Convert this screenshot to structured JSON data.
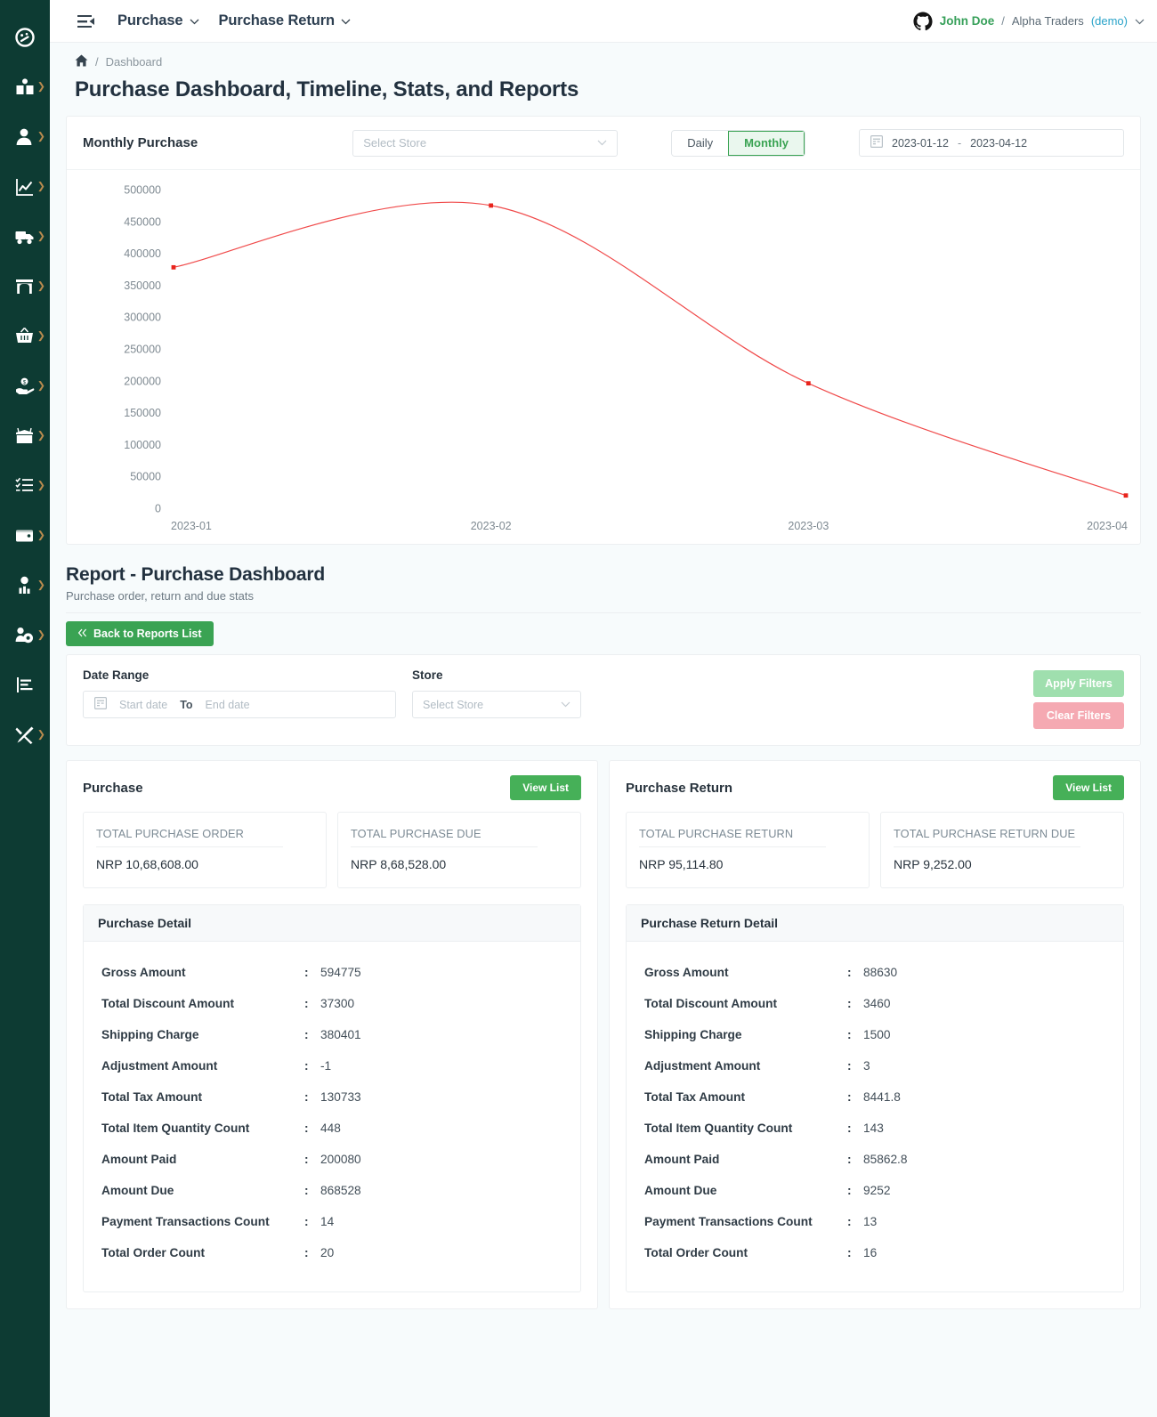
{
  "sidebar": {
    "items": [
      {
        "name": "dashboard",
        "icon": "speedometer-icon",
        "submenu": false
      },
      {
        "name": "catalog",
        "icon": "open-book-icon",
        "submenu": true
      },
      {
        "name": "customers",
        "icon": "user-icon",
        "submenu": true
      },
      {
        "name": "sales",
        "icon": "chart-line-icon",
        "submenu": true
      },
      {
        "name": "shipping",
        "icon": "truck-icon",
        "submenu": true
      },
      {
        "name": "store",
        "icon": "storefront-icon",
        "submenu": true
      },
      {
        "name": "purchase",
        "icon": "basket-icon",
        "submenu": true
      },
      {
        "name": "expense",
        "icon": "hand-money-icon",
        "submenu": true
      },
      {
        "name": "inventory",
        "icon": "box-open-icon",
        "submenu": true
      },
      {
        "name": "tasks",
        "icon": "checklist-icon",
        "submenu": true
      },
      {
        "name": "accounts",
        "icon": "wallet-icon",
        "submenu": true
      },
      {
        "name": "hr",
        "icon": "employee-icon",
        "submenu": true
      },
      {
        "name": "user-management",
        "icon": "users-gear-icon",
        "submenu": true
      },
      {
        "name": "reports",
        "icon": "bar-chart-icon",
        "submenu": false
      },
      {
        "name": "settings",
        "icon": "tools-icon",
        "submenu": true
      }
    ]
  },
  "topnav": {
    "menu_icon": "hamburger-collapse-icon",
    "links": [
      {
        "label": "Purchase"
      },
      {
        "label": "Purchase Return"
      }
    ],
    "account": {
      "avatar_icon": "github-icon",
      "user": "John Doe",
      "separator": "/",
      "org": "Alpha Traders",
      "demo": "(demo)",
      "chevron": "chevron-down-icon"
    }
  },
  "breadcrumb": {
    "home_icon": "home-icon",
    "separator": "/",
    "current": "Dashboard"
  },
  "page": {
    "title": "Purchase Dashboard, Timeline, Stats, and Reports"
  },
  "chart_card": {
    "title": "Monthly Purchase",
    "store_select": {
      "placeholder": "Select Store",
      "value": "",
      "chevron": "chevron-down-icon"
    },
    "segments": [
      {
        "label": "Daily",
        "active": false
      },
      {
        "label": "Monthly",
        "active": true
      }
    ],
    "date_range": {
      "icon": "calendar-icon",
      "start": "2023-01-12",
      "dash": "-",
      "end": "2023-04-12"
    }
  },
  "chart_data": {
    "type": "line",
    "title": "Monthly Purchase",
    "xlabel": "",
    "ylabel": "",
    "categories": [
      "2023-01",
      "2023-02",
      "2023-03",
      "2023-04"
    ],
    "x_tick_labels": [
      "2023-01",
      "2023-02",
      "2023-03",
      "2023-04"
    ],
    "y_tick_labels": [
      "0",
      "50000",
      "100000",
      "150000",
      "200000",
      "250000",
      "300000",
      "350000",
      "400000",
      "450000",
      "500000"
    ],
    "ylim": [
      0,
      500000
    ],
    "y_step": 50000,
    "grid": false,
    "legend": "none",
    "series": [
      {
        "name": "Monthly Purchase",
        "color": "#f04a4a",
        "values": [
          378000,
          475000,
          196000,
          20000
        ]
      }
    ]
  },
  "report": {
    "title": "Report - Purchase Dashboard",
    "subtitle": "Purchase order, return and due stats",
    "back_button": {
      "label": "Back to Reports List",
      "icon": "double-chevron-left-icon"
    }
  },
  "filters": {
    "date_range_label": "Date Range",
    "store_label": "Store",
    "date_icon": "calendar-icon",
    "start_placeholder": "Start date",
    "to_label": "To",
    "end_placeholder": "End date",
    "start_value": "",
    "end_value": "",
    "store_placeholder": "Select Store",
    "store_value": "",
    "store_chevron": "chevron-down-icon",
    "apply_label": "Apply Filters",
    "clear_label": "Clear Filters"
  },
  "panels": [
    {
      "title": "Purchase",
      "view_list_label": "View List",
      "stats": [
        {
          "label": "TOTAL PURCHASE ORDER",
          "value": "NRP 10,68,608.00"
        },
        {
          "label": "TOTAL PURCHASE DUE",
          "value": "NRP 8,68,528.00"
        }
      ],
      "detail_title": "Purchase Detail",
      "rows": [
        {
          "label": "Gross Amount",
          "value": "594775"
        },
        {
          "label": "Total Discount Amount",
          "value": "37300"
        },
        {
          "label": "Shipping Charge",
          "value": "380401"
        },
        {
          "label": "Adjustment Amount",
          "value": "-1"
        },
        {
          "label": "Total Tax Amount",
          "value": "130733"
        },
        {
          "label": "Total Item Quantity Count",
          "value": "448"
        },
        {
          "label": "Amount Paid",
          "value": "200080"
        },
        {
          "label": "Amount Due",
          "value": "868528"
        },
        {
          "label": "Payment Transactions Count",
          "value": "14"
        },
        {
          "label": "Total Order Count",
          "value": "20"
        }
      ]
    },
    {
      "title": "Purchase Return",
      "view_list_label": "View List",
      "stats": [
        {
          "label": "TOTAL PURCHASE RETURN",
          "value": "NRP 95,114.80"
        },
        {
          "label": "TOTAL PURCHASE RETURN DUE",
          "value": "NRP 9,252.00"
        }
      ],
      "detail_title": "Purchase Return Detail",
      "rows": [
        {
          "label": "Gross Amount",
          "value": "88630"
        },
        {
          "label": "Total Discount Amount",
          "value": "3460"
        },
        {
          "label": "Shipping Charge",
          "value": "1500"
        },
        {
          "label": "Adjustment Amount",
          "value": "3"
        },
        {
          "label": "Total Tax Amount",
          "value": "8441.8"
        },
        {
          "label": "Total Item Quantity Count",
          "value": "143"
        },
        {
          "label": "Amount Paid",
          "value": "85862.8"
        },
        {
          "label": "Amount Due",
          "value": "9252"
        },
        {
          "label": "Payment Transactions Count",
          "value": "13"
        },
        {
          "label": "Total Order Count",
          "value": "16"
        }
      ]
    }
  ],
  "colors": {
    "sidebar_bg": "#0d3b33",
    "accent_green": "#3aa353",
    "chart_line": "#f04a4a",
    "link_blue": "#29a3c9"
  }
}
